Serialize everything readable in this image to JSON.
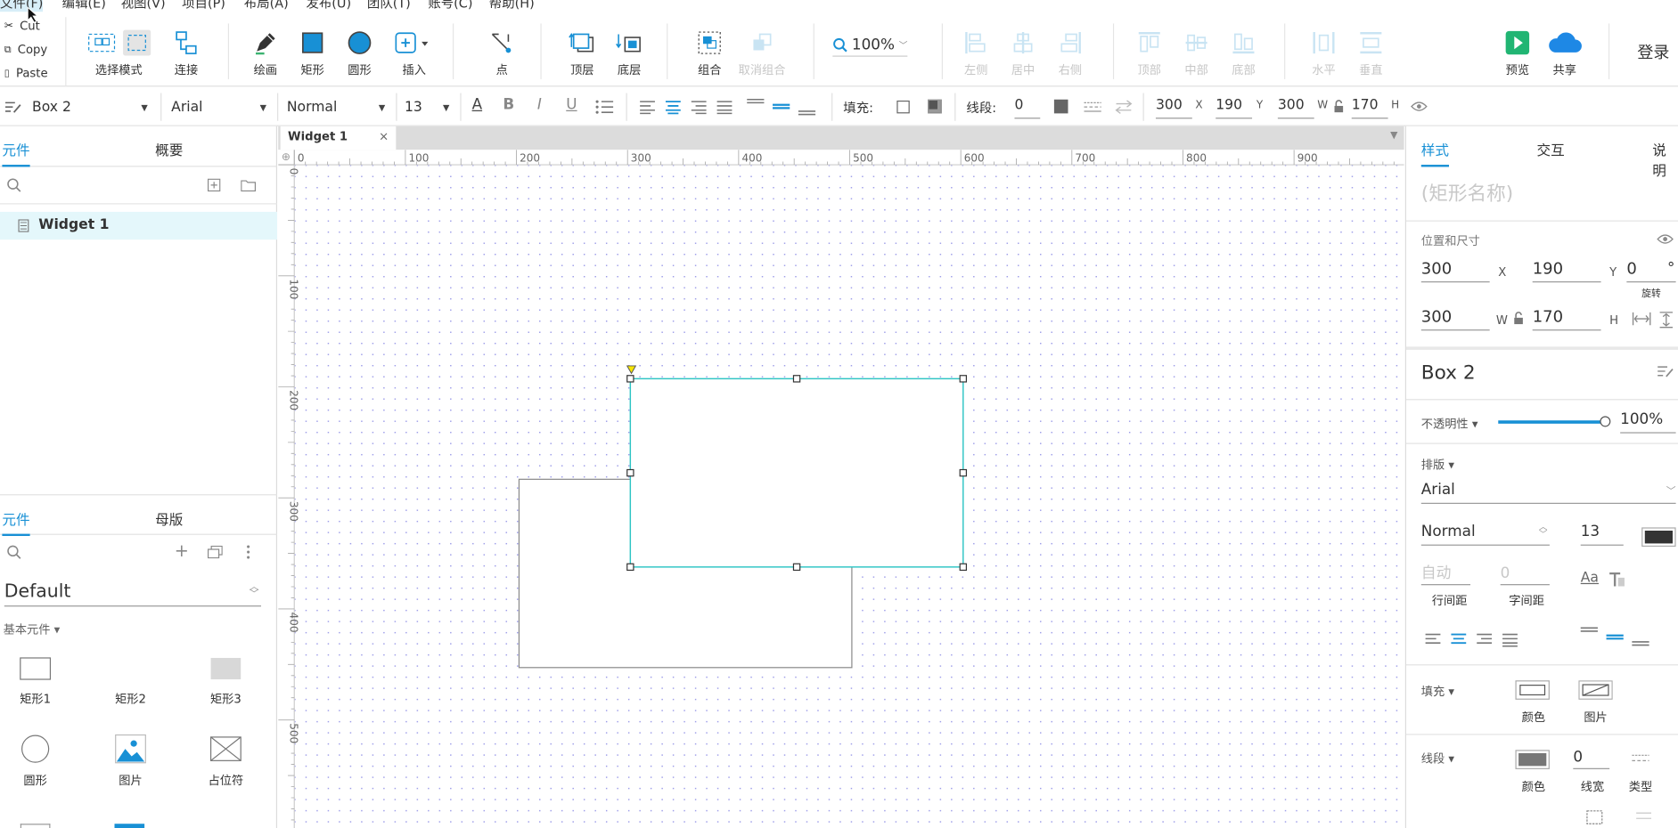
{
  "menubar": {
    "items": [
      "文件(F)",
      "编辑(E)",
      "视图(V)",
      "项目(P)",
      "布局(A)",
      "发布(U)",
      "团队(T)",
      "账号(C)",
      "帮助(H)"
    ]
  },
  "clipboard": {
    "cut": "Cut",
    "copy": "Copy",
    "paste": "Paste"
  },
  "toolbar": {
    "select_mode": "选择模式",
    "connect": "连接",
    "draw": "绘画",
    "rect": "矩形",
    "circle": "圆形",
    "insert": "插入",
    "point": "点",
    "top_layer": "顶层",
    "bottom_layer": "底层",
    "group": "组合",
    "ungroup": "取消组合",
    "zoom": "100%",
    "align_left": "左侧",
    "align_center": "居中",
    "align_right": "右侧",
    "align_top": "顶部",
    "align_middle": "中部",
    "align_bottom": "底部",
    "dist_h": "水平",
    "dist_v": "垂直",
    "preview": "预览",
    "share": "共享",
    "login": "登录"
  },
  "format": {
    "widget_name": "Box 2",
    "font": "Arial",
    "weight": "Normal",
    "size": "13",
    "fill_label": "填充:",
    "stroke_label": "线段:",
    "stroke_width": "0",
    "x": "300",
    "y": "190",
    "w": "300",
    "h": "170",
    "x_label": "X",
    "y_label": "Y",
    "w_label": "W",
    "h_label": "H"
  },
  "left_panel": {
    "tab_widgets": "元件",
    "tab_outline": "概要",
    "page_item": "Widget 1",
    "lib_tab_widgets": "元件",
    "lib_tab_masters": "母版",
    "library": "Default",
    "category": "基本元件 ▾",
    "widgets": [
      "矩形1",
      "矩形2",
      "矩形3",
      "圆形",
      "图片",
      "占位符"
    ]
  },
  "canvas": {
    "tab": "Widget 1",
    "ruler_x": [
      "0",
      "100",
      "200",
      "300",
      "400",
      "500",
      "600",
      "700",
      "800",
      "900"
    ],
    "ruler_y": [
      "0",
      "100",
      "200",
      "300",
      "400",
      "500"
    ]
  },
  "right_panel": {
    "tab_style": "样式",
    "tab_interaction": "交互",
    "tab_notes": "说明",
    "shape_name_placeholder": "(矩形名称)",
    "pos_size_label": "位置和尺寸",
    "x": "300",
    "y": "190",
    "rot": "0",
    "w": "300",
    "h": "170",
    "x_label": "X",
    "y_label": "Y",
    "w_label": "W",
    "h_label": "H",
    "rot_label": "旋转",
    "deg": "°",
    "widget_name": "Box 2",
    "opacity_label": "不透明性 ▾",
    "opacity": "100%",
    "opacity_fraction": 1.0,
    "typography_label": "排版 ▾",
    "font": "Arial",
    "weight": "Normal",
    "size": "13",
    "line_spacing_value": "自动",
    "line_spacing_label": "行间距",
    "char_spacing_value": "0",
    "char_spacing_label": "字间距",
    "fill_label": "填充 ▾",
    "fill_color_label": "颜色",
    "fill_image_label": "图片",
    "stroke_label": "线段 ▾",
    "stroke_color_label": "颜色",
    "stroke_width": "0",
    "stroke_width_label": "线宽",
    "stroke_type_label": "类型"
  },
  "colors": {
    "accent": "#1890d5",
    "selection": "#2ec4c4",
    "dot": "#9a9ae8"
  }
}
